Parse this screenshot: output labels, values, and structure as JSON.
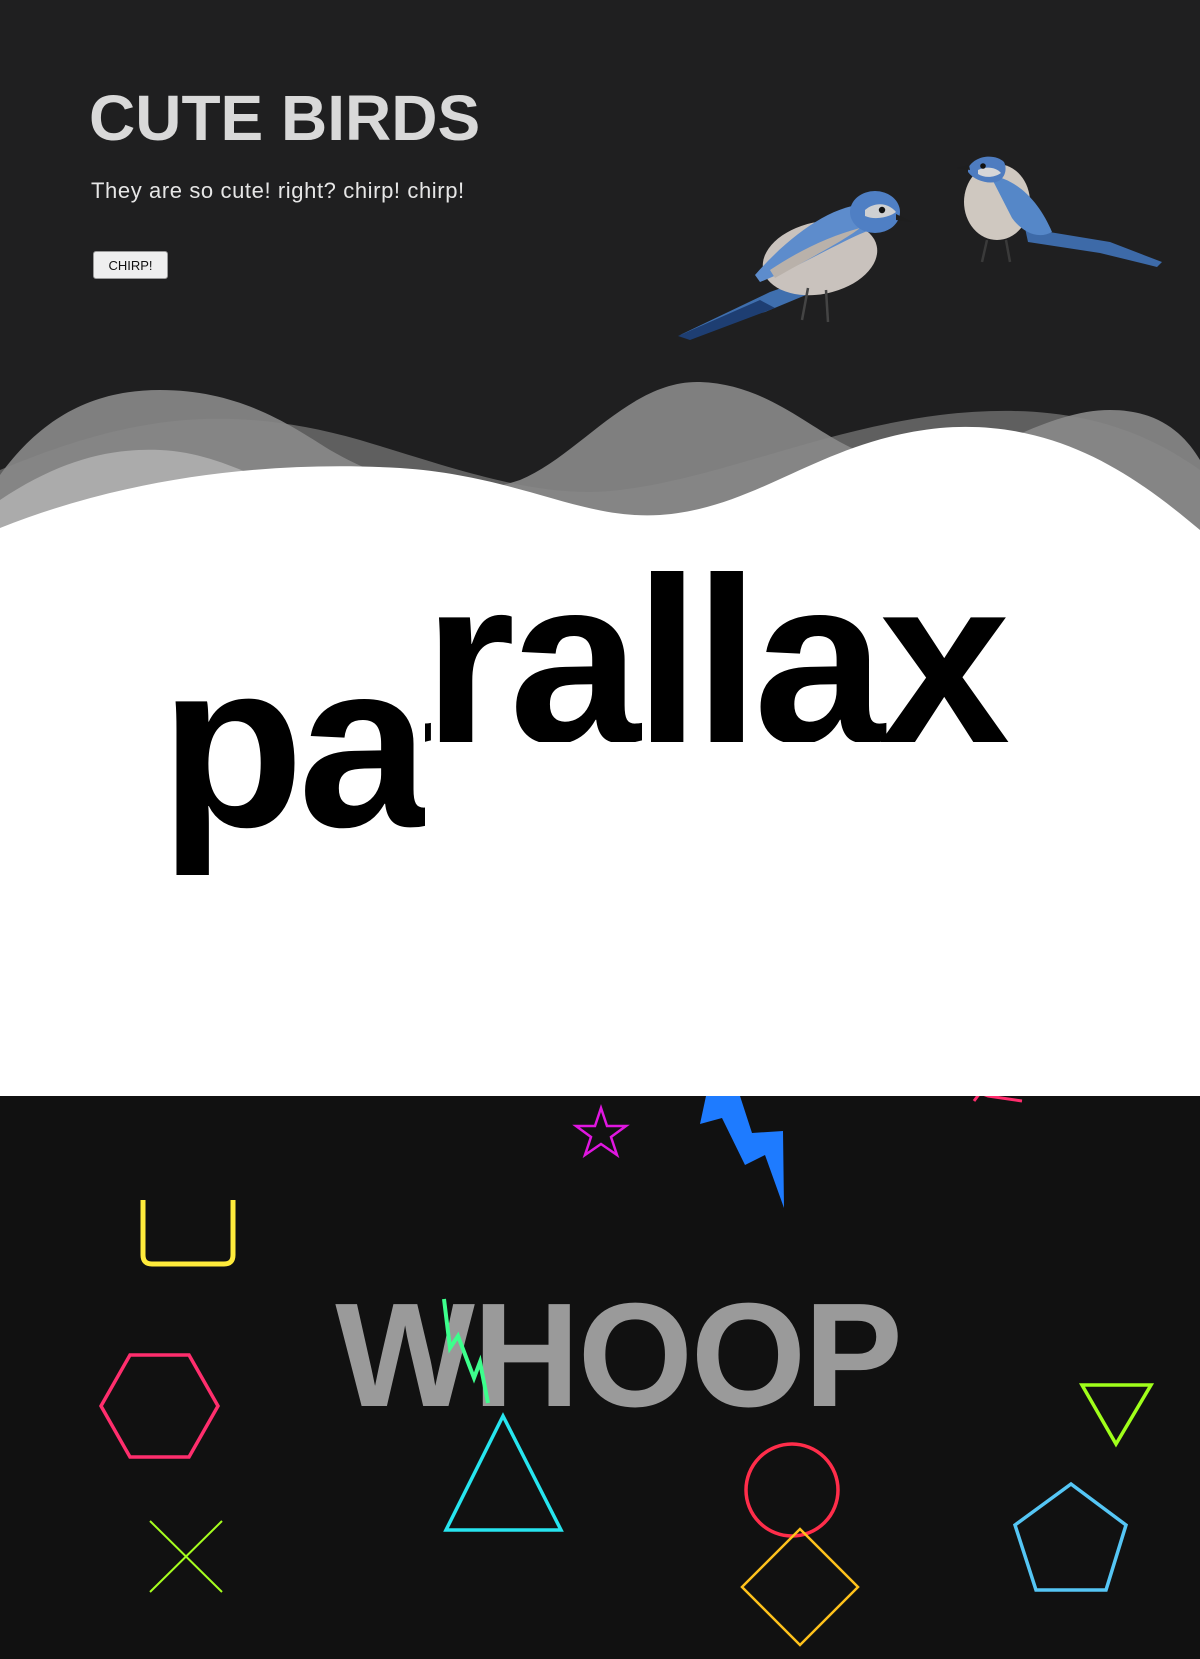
{
  "hero": {
    "title": "CUTE BIRDS",
    "subtitle": "They are so cute! right? chirp! chirp!",
    "button_label": "CHIRP!",
    "background": "#1f1f20",
    "hill_colors": [
      "#5f5f5f",
      "#8a8a8a",
      "#ababab"
    ]
  },
  "parallax": {
    "word": "parallax",
    "text_color": "#000000",
    "panel_color": "#ffffff"
  },
  "whoop": {
    "word": "WHOOP",
    "text_color": "#9a9a9a",
    "background": "#111111"
  },
  "shapes": [
    {
      "name": "star-icon",
      "color": "#e016e0"
    },
    {
      "name": "lightning-icon",
      "color": "#1e7bff"
    },
    {
      "name": "lightning-small-icon",
      "color": "#3dff8c"
    },
    {
      "name": "square-bracket-icon",
      "color": "#ffeb3b"
    },
    {
      "name": "hexagon-icon",
      "color": "#ff2e6d"
    },
    {
      "name": "triangle-icon",
      "color": "#27e5ef"
    },
    {
      "name": "circle-icon",
      "color": "#ff2d4a"
    },
    {
      "name": "diamond-icon",
      "color": "#ffc21c"
    },
    {
      "name": "cross-icon",
      "color": "#a6ff1f"
    },
    {
      "name": "triangle-down-icon",
      "color": "#a0ff1a"
    },
    {
      "name": "pentagon-icon",
      "color": "#55c6f5"
    },
    {
      "name": "chevron-icon",
      "color": "#ff2d6d"
    }
  ]
}
